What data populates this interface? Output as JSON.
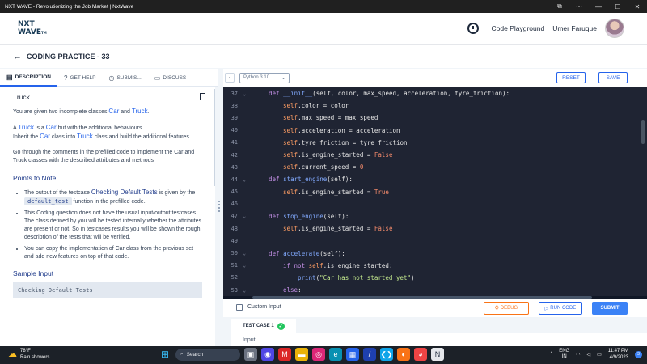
{
  "window": {
    "title": "NXT WAVE - Revolutionizing the Job Market | NxtWave",
    "controls": [
      "⧉",
      "⋯",
      "—",
      "☐",
      "✕"
    ]
  },
  "header": {
    "logo_line1": "NXT",
    "logo_line2": "WAVE",
    "logo_tm": "TM",
    "code_playground": "Code Playground",
    "user_name": "Umer Faruque"
  },
  "subheader": {
    "back": "←",
    "title": "CODING PRACTICE - 33"
  },
  "left_tabs": [
    {
      "label": "DESCRIPTION",
      "icon": "▤",
      "active": true
    },
    {
      "label": "GET HELP",
      "icon": "?"
    },
    {
      "label": "SUBMIS...",
      "icon": "◷"
    },
    {
      "label": "DISCUSS",
      "icon": "▭"
    }
  ],
  "question": {
    "title": "Truck",
    "p1_pre": "You are given two incomplete classes ",
    "p1_car": "Car",
    "p1_and": " and ",
    "p1_truck": "Truck",
    "p1_post": ".",
    "p2_a": "A ",
    "p2_truck": "Truck",
    "p2_b": " is a ",
    "p2_car": "Car",
    "p2_c": " but with the additional behaviours.",
    "p2_d": "Inherit the ",
    "p2_car2": "Car",
    "p2_e": " class into ",
    "p2_truck2": "Truck",
    "p2_f": " class and build the additional features.",
    "p3": "Go through the comments in the prefilled code to implement the Car and Truck classes with the described attributes and methods",
    "points_head": "Points to Note",
    "n1_a": "The output of the testcase ",
    "n1_hl": "Checking Default Tests",
    "n1_b": " is given by the ",
    "n1_code": "default_test",
    "n1_c": " function in the prefilled code.",
    "n2": "This Coding question does not have the usual input/output testcases. The class defined by you will be tested internally whether the attributes are present or not. So in testcases results you will be shown the rough description of the tests that will be verified.",
    "n3": "You can copy the implementation of Car class from the previous set and add new features on top of that code.",
    "sample_head": "Sample Input",
    "sample_text": "Checking Default Tests"
  },
  "editor": {
    "chev": "‹",
    "language": "Python 3.10",
    "reset": "RESET",
    "save": "SAVE",
    "lines": [
      {
        "n": "37",
        "fold": true,
        "indent": 4,
        "tokens": [
          [
            "kw",
            "def "
          ],
          [
            "fn",
            "__init__"
          ],
          [
            "code",
            "(self, color, max_speed, acceleration, tyre_friction):"
          ]
        ]
      },
      {
        "n": "38",
        "indent": 8,
        "tokens": [
          [
            "sf",
            "self"
          ],
          [
            "code",
            ".color = color"
          ]
        ]
      },
      {
        "n": "39",
        "indent": 8,
        "tokens": [
          [
            "sf",
            "self"
          ],
          [
            "code",
            ".max_speed = max_speed"
          ]
        ]
      },
      {
        "n": "40",
        "indent": 8,
        "tokens": [
          [
            "sf",
            "self"
          ],
          [
            "code",
            ".acceleration = acceleration"
          ]
        ]
      },
      {
        "n": "41",
        "indent": 8,
        "tokens": [
          [
            "sf",
            "self"
          ],
          [
            "code",
            ".tyre_friction = tyre_friction"
          ]
        ]
      },
      {
        "n": "42",
        "indent": 8,
        "tokens": [
          [
            "sf",
            "self"
          ],
          [
            "code",
            ".is_engine_started = "
          ],
          [
            "bool",
            "False"
          ]
        ]
      },
      {
        "n": "43",
        "indent": 8,
        "tokens": [
          [
            "sf",
            "self"
          ],
          [
            "code",
            ".current_speed = "
          ],
          [
            "bool",
            "0"
          ]
        ]
      },
      {
        "n": "44",
        "fold": true,
        "indent": 4,
        "tokens": [
          [
            "kw",
            "def "
          ],
          [
            "fn",
            "start_engine"
          ],
          [
            "code",
            "(self):"
          ]
        ]
      },
      {
        "n": "45",
        "indent": 8,
        "tokens": [
          [
            "sf",
            "self"
          ],
          [
            "code",
            ".is_engine_started = "
          ],
          [
            "bool",
            "True"
          ]
        ]
      },
      {
        "n": "46",
        "indent": 0,
        "tokens": []
      },
      {
        "n": "47",
        "fold": true,
        "indent": 4,
        "tokens": [
          [
            "kw",
            "def "
          ],
          [
            "fn",
            "stop_engine"
          ],
          [
            "code",
            "(self):"
          ]
        ]
      },
      {
        "n": "48",
        "indent": 8,
        "tokens": [
          [
            "sf",
            "self"
          ],
          [
            "code",
            ".is_engine_started = "
          ],
          [
            "bool",
            "False"
          ]
        ]
      },
      {
        "n": "49",
        "indent": 0,
        "tokens": []
      },
      {
        "n": "50",
        "fold": true,
        "indent": 4,
        "tokens": [
          [
            "kw",
            "def "
          ],
          [
            "fn",
            "accelerate"
          ],
          [
            "code",
            "(self):"
          ]
        ]
      },
      {
        "n": "51",
        "fold": true,
        "indent": 8,
        "tokens": [
          [
            "kw",
            "if not "
          ],
          [
            "sf",
            "self"
          ],
          [
            "code",
            ".is_engine_started:"
          ]
        ]
      },
      {
        "n": "52",
        "indent": 12,
        "tokens": [
          [
            "fn",
            "print"
          ],
          [
            "code",
            "("
          ],
          [
            "str",
            "\"Car has not started yet\""
          ],
          [
            "code",
            ")"
          ]
        ]
      },
      {
        "n": "53",
        "fold": true,
        "indent": 8,
        "tokens": [
          [
            "kw",
            "else"
          ],
          [
            "code",
            ":"
          ]
        ]
      }
    ]
  },
  "actions": {
    "custom_input": "Custom Input",
    "debug": "DEBUG",
    "debug_icon": "⛭",
    "run": "RUN CODE",
    "run_icon": "▷",
    "submit": "SUBMIT"
  },
  "tests": {
    "tab": "TEST CASE 1",
    "input_label": "Input"
  },
  "taskbar": {
    "temp": "78°F",
    "weather": "Rain showers",
    "search": "Search",
    "lang1": "ENG",
    "lang2": "IN",
    "time": "11:47 PM",
    "date": "4/9/2023",
    "notif_count": "3"
  }
}
